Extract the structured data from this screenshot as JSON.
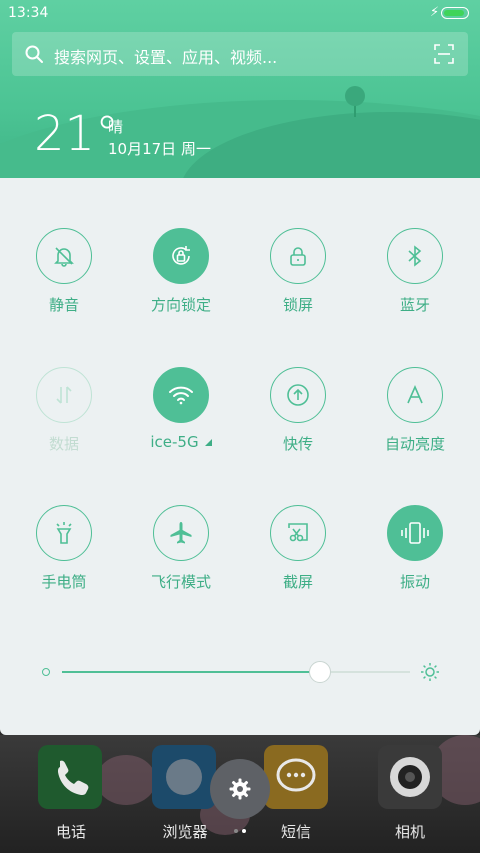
{
  "status": {
    "time": "13:34",
    "charging_icon": "bolt-icon",
    "battery_level": 0.95
  },
  "search": {
    "placeholder": "搜索网页、设置、应用、视频..."
  },
  "weather": {
    "temperature": "21°",
    "condition": "晴",
    "date": "10月17日 周一"
  },
  "quick_toggles": [
    {
      "label": "静音",
      "icon": "bell-off-icon",
      "state": "off"
    },
    {
      "label": "方向锁定",
      "icon": "rotation-lock-icon",
      "state": "on"
    },
    {
      "label": "锁屏",
      "icon": "lock-icon",
      "state": "off"
    },
    {
      "label": "蓝牙",
      "icon": "bluetooth-icon",
      "state": "off"
    },
    {
      "label": "数据",
      "icon": "mobile-data-icon",
      "state": "disabled"
    },
    {
      "label": "ice-5G",
      "icon": "wifi-icon",
      "state": "on"
    },
    {
      "label": "快传",
      "icon": "quick-transfer-icon",
      "state": "off"
    },
    {
      "label": "自动亮度",
      "icon": "auto-brightness-icon",
      "state": "off"
    },
    {
      "label": "手电筒",
      "icon": "flashlight-icon",
      "state": "off"
    },
    {
      "label": "飞行模式",
      "icon": "airplane-icon",
      "state": "off"
    },
    {
      "label": "截屏",
      "icon": "screenshot-icon",
      "state": "off"
    },
    {
      "label": "振动",
      "icon": "vibrate-icon",
      "state": "on"
    }
  ],
  "brightness": {
    "level": 0.74
  },
  "dock": {
    "apps": [
      {
        "label": "电话",
        "icon": "phone-icon"
      },
      {
        "label": "浏览器",
        "icon": "browser-icon"
      },
      {
        "label": "短信",
        "icon": "message-icon"
      },
      {
        "label": "相机",
        "icon": "camera-icon"
      }
    ],
    "settings_icon": "gear-icon",
    "page_indicator": {
      "count": 2,
      "current": 2
    }
  },
  "colors": {
    "accent": "#4fbf96",
    "panel": "#ecf1f2",
    "header": "#4cc494"
  }
}
